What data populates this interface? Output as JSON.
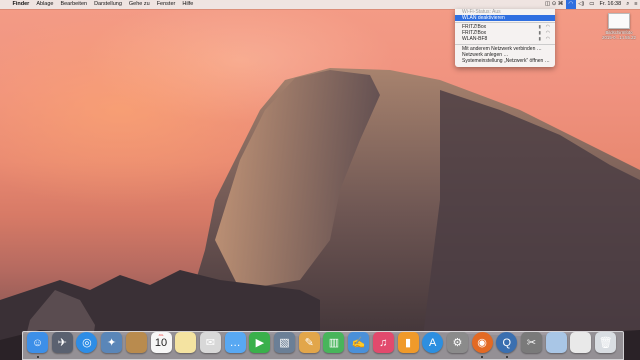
{
  "menubar": {
    "apple": "",
    "items": [
      "Finder",
      "Ablage",
      "Bearbeiten",
      "Darstellung",
      "Gehe zu",
      "Fenster",
      "Hilfe"
    ],
    "status": {
      "icons_left": "◫ ⊙ ⌘",
      "wifi": "◠",
      "volume": "◁)",
      "flag": "▭",
      "clock": "Fr. 16:38",
      "search": "⌕",
      "list": "≡"
    }
  },
  "wifi_menu": {
    "header": "Wi-Fi-Status: Aus",
    "selected": "WLAN deaktivieren",
    "networks": [
      {
        "name": "FRITZ!Box"
      },
      {
        "name": "FRITZ!Box"
      },
      {
        "name": "WLAN-BF8"
      }
    ],
    "actions": [
      "Mit anderem Netzwerk verbinden …",
      "Netzwerk anlegen …",
      "Systemeinstellung „Netzwerk“ öffnen …"
    ]
  },
  "desktop_file": {
    "label_line1": "Bildschirmfoto",
    "label_line2": "2015-0...14.55.22"
  },
  "dock": {
    "icons": [
      {
        "name": "finder-icon",
        "color": "#3d8fe8",
        "glyph": "☺",
        "running": true
      },
      {
        "name": "launchpad-icon",
        "color": "#5a6170",
        "glyph": "✈",
        "running": false
      },
      {
        "name": "safari-icon",
        "color": "#2e8de6",
        "glyph": "◎",
        "running": false
      },
      {
        "name": "photos-icon",
        "color": "#5a86b8",
        "glyph": "✦",
        "running": false
      },
      {
        "name": "notebook-icon",
        "color": "#b98b4e",
        "glyph": "",
        "running": false
      },
      {
        "name": "calendar-icon",
        "color": "#f7f7f7",
        "glyph": "",
        "running": false
      },
      {
        "name": "notes-icon",
        "color": "#f4e3a1",
        "glyph": "",
        "running": false
      },
      {
        "name": "preview-icon",
        "color": "#d8d8d8",
        "glyph": "✉",
        "running": false
      },
      {
        "name": "messages-icon",
        "color": "#58a8f2",
        "glyph": "…",
        "running": false
      },
      {
        "name": "facetime-icon",
        "color": "#3ab04b",
        "glyph": "▶",
        "running": false
      },
      {
        "name": "photo-booth-icon",
        "color": "#6b7f96",
        "glyph": "▧",
        "running": false
      },
      {
        "name": "keynote-icon",
        "color": "#e2a64a",
        "glyph": "✎",
        "running": false
      },
      {
        "name": "numbers-icon",
        "color": "#48b55b",
        "glyph": "▥",
        "running": false
      },
      {
        "name": "pages-icon",
        "color": "#4a90d9",
        "glyph": "✍",
        "running": false
      },
      {
        "name": "itunes-icon",
        "color": "#e24a6d",
        "glyph": "♫",
        "running": false
      },
      {
        "name": "ibooks-icon",
        "color": "#f09a2a",
        "glyph": "▮",
        "running": false
      },
      {
        "name": "app-store-icon",
        "color": "#2d8fe0",
        "glyph": "A",
        "running": false
      },
      {
        "name": "system-preferences-icon",
        "color": "#8b8b8b",
        "glyph": "⚙",
        "running": false
      },
      {
        "name": "firefox-icon",
        "color": "#e36a24",
        "glyph": "◉",
        "running": true
      },
      {
        "name": "quicktime-icon",
        "color": "#3a6fb0",
        "glyph": "Q",
        "running": true
      },
      {
        "name": "clapper-icon",
        "color": "#7a7a7a",
        "glyph": "✂",
        "running": false
      },
      {
        "name": "downloads-folder-icon",
        "color": "#a9c6e6",
        "glyph": "",
        "running": false
      },
      {
        "name": "document-stack-icon",
        "color": "#e9e9e9",
        "glyph": "",
        "running": false
      },
      {
        "name": "trash-icon",
        "color": "#d9dde2",
        "glyph": "🗑",
        "running": false
      }
    ],
    "calendar": {
      "month": "JUL",
      "day": "10"
    }
  }
}
